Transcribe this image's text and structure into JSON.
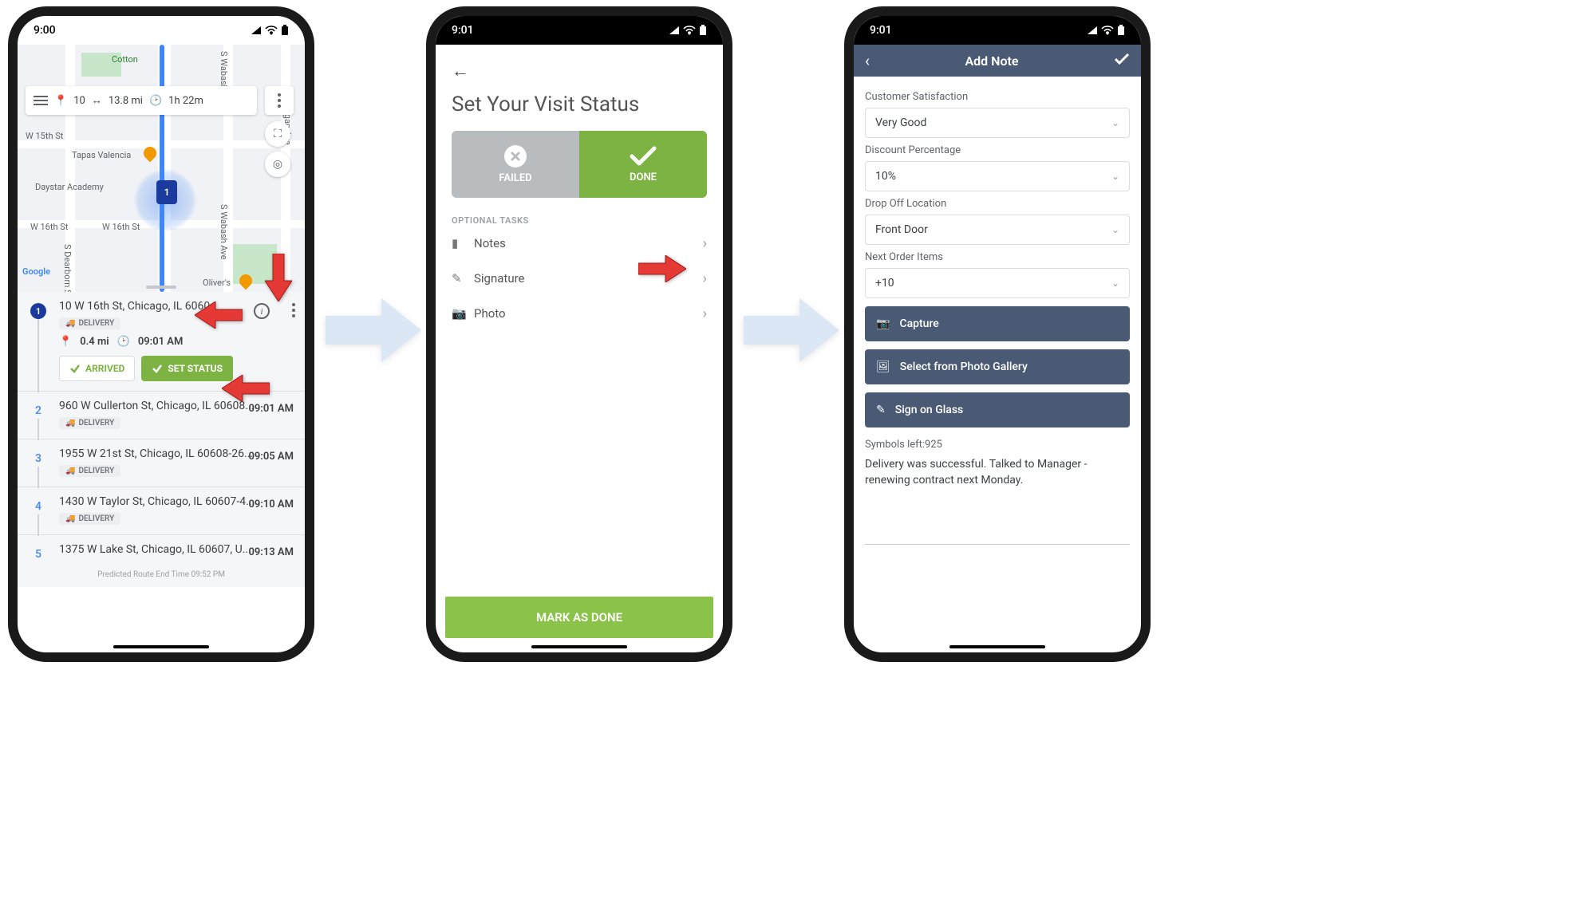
{
  "phone1": {
    "status_time": "9:00",
    "summary": {
      "stops": "10",
      "distance": "13.8 mi",
      "duration": "1h 22m"
    },
    "map": {
      "poi_tapas": "Tapas Valencia",
      "poi_daystar": "Daystar Academy",
      "poi_olivers": "Oliver's",
      "poi_cotton": "Cotton",
      "street_15": "W 15th St",
      "street_16a": "W 16th St",
      "street_16b": "W 16th St",
      "street_wabash_n": "S Wabash Ave",
      "street_wabash_s": "S Wabash Ave",
      "street_michigan": "Michigan Ave",
      "street_dearborn": "S Dearborn St",
      "attribution": "Google",
      "marker1": "1"
    },
    "primary_stop": {
      "num": "1",
      "address": "10 W 16th St, Chicago, IL 6060",
      "tag": "DELIVERY",
      "distance": "0.4 mi",
      "eta": "09:01 AM",
      "btn_arrived": "ARRIVED",
      "btn_setstatus": "SET STATUS"
    },
    "stops": [
      {
        "num": "2",
        "address": "960 W Cullerton St, Chicago, IL 60608...",
        "tag": "DELIVERY",
        "time": "09:01 AM"
      },
      {
        "num": "3",
        "address": "1955 W 21st St, Chicago, IL 60608-26...",
        "tag": "DELIVERY",
        "time": "09:05 AM"
      },
      {
        "num": "4",
        "address": "1430 W Taylor St, Chicago, IL 60607-4...",
        "tag": "DELIVERY",
        "time": "09:10 AM"
      },
      {
        "num": "5",
        "address": "1375 W Lake St, Chicago, IL 60607, U...",
        "tag": "",
        "time": "09:13 AM"
      }
    ],
    "footer": "Predicted Route End Time 09:52 PM"
  },
  "phone2": {
    "status_time": "9:01",
    "title": "Set Your Visit Status",
    "failed": "FAILED",
    "done": "DONE",
    "optional_label": "OPTIONAL TASKS",
    "row_notes": "Notes",
    "row_signature": "Signature",
    "row_photo": "Photo",
    "cta": "MARK AS DONE"
  },
  "phone3": {
    "status_time": "9:01",
    "header": "Add Note",
    "fields": {
      "sat_label": "Customer Satisfaction",
      "sat_value": "Very Good",
      "disc_label": "Discount Percentage",
      "disc_value": "10%",
      "drop_label": "Drop Off Location",
      "drop_value": "Front Door",
      "next_label": "Next Order Items",
      "next_value": "+10"
    },
    "btn_capture": "Capture",
    "btn_gallery": "Select from Photo Gallery",
    "btn_sign": "Sign on Glass",
    "symbols": "Symbols left:925",
    "note_text": "Delivery was successful. Talked to Manager - renewing contract next Monday."
  }
}
